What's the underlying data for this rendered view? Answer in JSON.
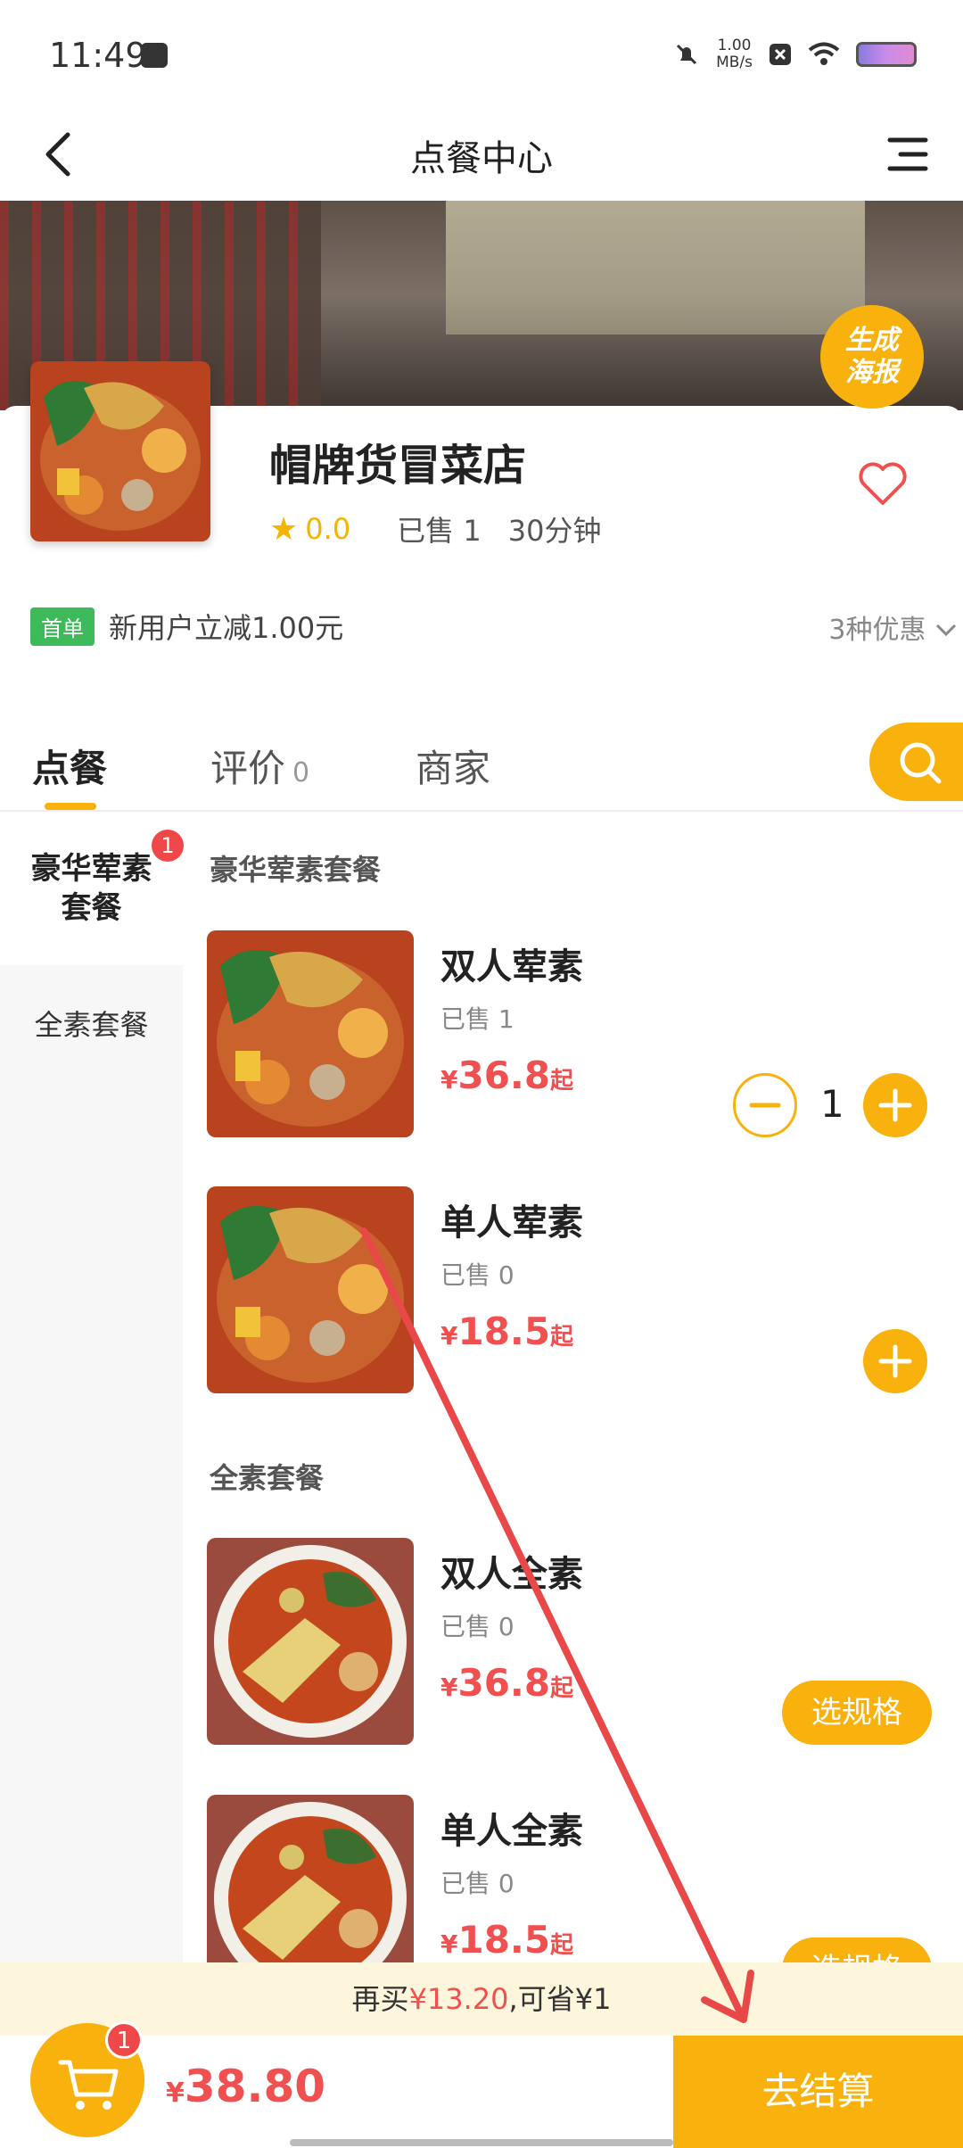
{
  "status_bar": {
    "time": "11:49",
    "net_speed_value": "1.00",
    "net_speed_unit": "MB/s"
  },
  "nav": {
    "title": "点餐中心"
  },
  "banner": {
    "poster_label_line1": "生成",
    "poster_label_line2": "海报"
  },
  "shop": {
    "name": "帽牌货冒菜店",
    "rating": "0.0",
    "sold": "已售 1",
    "delivery_time": "30分钟",
    "promo_tag": "首单",
    "promo_text": "新用户立减1.00元",
    "promo_more": "3种优惠"
  },
  "tabs": [
    {
      "label": "点餐"
    },
    {
      "label": "评价",
      "count": "0"
    },
    {
      "label": "商家"
    }
  ],
  "categories": [
    {
      "label": "豪华荤素套餐",
      "badge": "1"
    },
    {
      "label": "全素套餐"
    }
  ],
  "sections": [
    {
      "title": "豪华荤素套餐",
      "products": [
        {
          "name": "双人荤素",
          "sold": "已售 1",
          "price": "36.8",
          "suffix": "起",
          "quantity": "1",
          "image": "meat-veg-noodle"
        },
        {
          "name": "单人荤素",
          "sold": "已售 0",
          "price": "18.5",
          "suffix": "起",
          "image": "meat-veg-noodle"
        }
      ]
    },
    {
      "title": "全素套餐",
      "products": [
        {
          "name": "双人全素",
          "sold": "已售 0",
          "price": "36.8",
          "suffix": "起",
          "button": "选规格",
          "image": "veg-noodle"
        },
        {
          "name": "单人全素",
          "sold": "已售 0",
          "price": "18.5",
          "suffix": "起",
          "button": "选规格",
          "image": "veg-noodle"
        }
      ]
    }
  ],
  "currency": "¥",
  "save_bar": {
    "prefix": "再买",
    "amount": "¥13.20",
    "suffix": ",可省¥1"
  },
  "cart": {
    "badge": "1",
    "total": "38.80",
    "checkout_label": "去结算"
  },
  "colors": {
    "accent": "#f9b10e",
    "price": "#f05150",
    "promo_tag": "#3fba5b",
    "badge": "#f04848",
    "annotation_arrow": "#e84848"
  }
}
